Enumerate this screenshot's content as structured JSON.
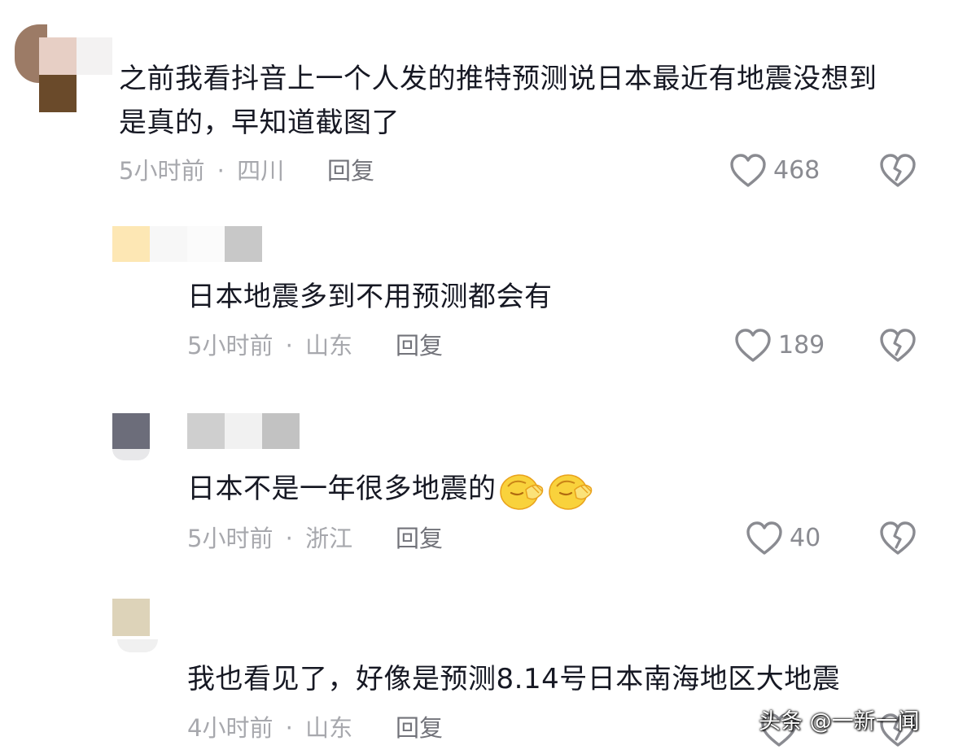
{
  "comments": [
    {
      "text_line1": "之前我看抖音上一个人发的推特预测说日本最近有地震没想到",
      "text_line2": "是真的，早知道截图了",
      "time": "5小时前",
      "location": "四川",
      "reply_label": "回复",
      "likes": "468"
    },
    {
      "text_line1": "日本地震多到不用预测都会有",
      "time": "5小时前",
      "location": "山东",
      "reply_label": "回复",
      "likes": "189"
    },
    {
      "text_line1": "日本不是一年很多地震的",
      "time": "5小时前",
      "location": "浙江",
      "reply_label": "回复",
      "likes": "40"
    },
    {
      "text_line1": "我也看见了，好像是预测8.14号日本南海地区大地震",
      "time": "4小时前",
      "location": "山东",
      "reply_label": "回复"
    }
  ],
  "separator": "·",
  "icons": {
    "like": "heart-outline-icon",
    "dislike": "broken-heart-icon",
    "emoji": "facepalm-emoji-icon"
  },
  "colors": {
    "text": "#161823",
    "meta": "#a7a8ad",
    "reply": "#72737a",
    "icon": "#8a8b91"
  },
  "watermark": "头条 @一新一闻"
}
